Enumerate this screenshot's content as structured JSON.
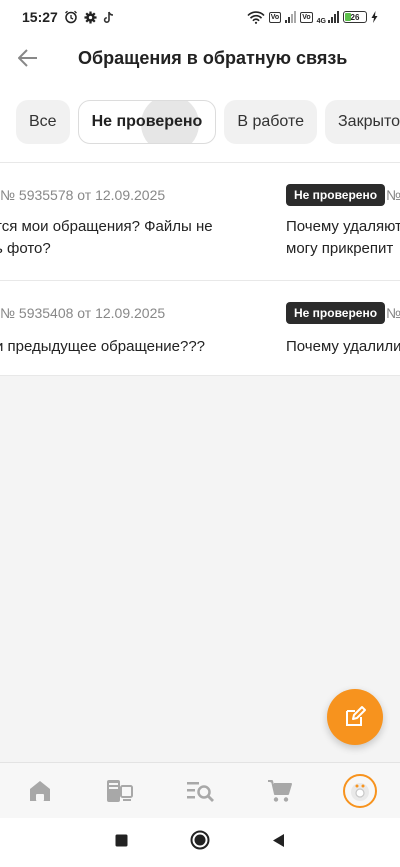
{
  "status_bar": {
    "time": "15:27",
    "battery": "26",
    "network": "4G",
    "icons": [
      "alarm-icon",
      "gear-icon",
      "tiktok-icon",
      "wifi-icon",
      "signal-icon",
      "volte-icon",
      "battery-icon",
      "charging-icon"
    ],
    "volte_label": "Vo\nLTE"
  },
  "header": {
    "title": "Обращения в обратную связь",
    "back_icon": "arrow-left-icon"
  },
  "filters": [
    {
      "label": "Все",
      "active": false
    },
    {
      "label": "Не проверено",
      "active": true
    },
    {
      "label": "В работе",
      "active": false
    },
    {
      "label": "Закрыто",
      "active": false
    }
  ],
  "requests": [
    {
      "left": {
        "meta": "№ 5935578 от 12.09.2025",
        "text_line1": "тся мои обращения? Файлы не",
        "text_line2": "ь фото?"
      },
      "right": {
        "status": "Не проверено",
        "meta": "№",
        "text_line1": "Почему удаляют",
        "text_line2": "могу прикрепит"
      }
    },
    {
      "left": {
        "meta": "№ 5935408 от 12.09.2025",
        "text_line1": "и предыдущее обращение???"
      },
      "right": {
        "status": "Не проверено",
        "meta": "№",
        "text_line1": "Почему удалили"
      }
    }
  ],
  "fab": {
    "icon": "edit-icon"
  },
  "bottom_nav": [
    {
      "icon": "home-icon"
    },
    {
      "icon": "catalog-icon"
    },
    {
      "icon": "search-list-icon"
    },
    {
      "icon": "cart-icon"
    },
    {
      "icon": "profile-icon",
      "active": true
    }
  ],
  "colors": {
    "accent": "#f7931e",
    "badge_bg": "#2b2b2b",
    "background": "#f4f4f4"
  }
}
